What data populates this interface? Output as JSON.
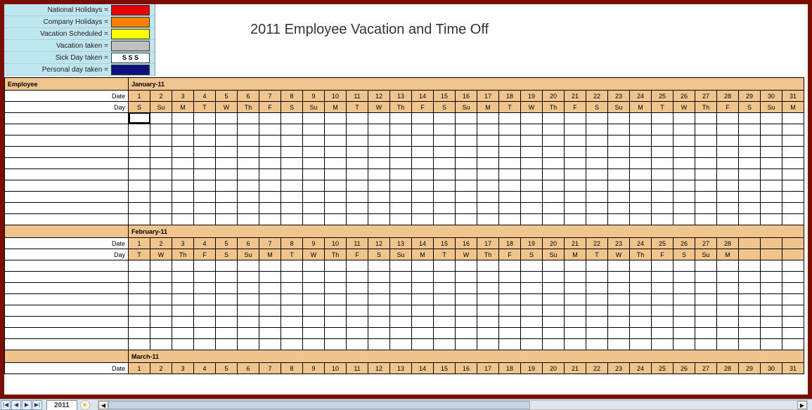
{
  "title": "2011 Employee Vacation and Time Off",
  "legend": [
    {
      "label": "National Holidays =",
      "color": "#e60000",
      "text": ""
    },
    {
      "label": "Company Holidays =",
      "color": "#ff7f00",
      "text": ""
    },
    {
      "label": "Vacation Scheduled =",
      "color": "#ffff00",
      "text": ""
    },
    {
      "label": "Vacation taken =",
      "color": "#bfbfbf",
      "text": ""
    },
    {
      "label": "Sick Day taken =",
      "color": "#ffffff",
      "text": "S   S   S"
    },
    {
      "label": "Personal day taken =",
      "color": "#10107f",
      "text": ""
    }
  ],
  "headers": {
    "employee": "Employee",
    "date_label": "Date",
    "day_label": "Day"
  },
  "months": [
    {
      "name": "January-11",
      "days_count": 31,
      "dates": [
        "1",
        "2",
        "3",
        "4",
        "5",
        "6",
        "7",
        "8",
        "9",
        "10",
        "11",
        "12",
        "13",
        "14",
        "15",
        "16",
        "17",
        "18",
        "19",
        "20",
        "21",
        "22",
        "23",
        "24",
        "25",
        "26",
        "27",
        "28",
        "29",
        "30",
        "31"
      ],
      "dows": [
        "S",
        "Su",
        "M",
        "T",
        "W",
        "Th",
        "F",
        "S",
        "Su",
        "M",
        "T",
        "W",
        "Th",
        "F",
        "S",
        "Su",
        "M",
        "T",
        "W",
        "Th",
        "F",
        "S",
        "Su",
        "M",
        "T",
        "W",
        "Th",
        "F",
        "S",
        "Su",
        "M"
      ],
      "blank_rows": 10
    },
    {
      "name": "February-11",
      "days_count": 28,
      "dates": [
        "1",
        "2",
        "3",
        "4",
        "5",
        "6",
        "7",
        "8",
        "9",
        "10",
        "11",
        "12",
        "13",
        "14",
        "15",
        "16",
        "17",
        "18",
        "19",
        "20",
        "21",
        "22",
        "23",
        "24",
        "25",
        "26",
        "27",
        "28"
      ],
      "dows": [
        "T",
        "W",
        "Th",
        "F",
        "S",
        "Su",
        "M",
        "T",
        "W",
        "Th",
        "F",
        "S",
        "Su",
        "M",
        "T",
        "W",
        "Th",
        "F",
        "S",
        "Su",
        "M",
        "T",
        "W",
        "Th",
        "F",
        "S",
        "Su",
        "M"
      ],
      "blank_rows": 8
    },
    {
      "name": "March-11",
      "days_count": 31,
      "dates": [
        "1",
        "2",
        "3",
        "4",
        "5",
        "6",
        "7",
        "8",
        "9",
        "10",
        "11",
        "12",
        "13",
        "14",
        "15",
        "16",
        "17",
        "18",
        "19",
        "20",
        "21",
        "22",
        "23",
        "24",
        "25",
        "26",
        "27",
        "28",
        "29",
        "30",
        "31"
      ],
      "dows": [],
      "blank_rows": 0
    }
  ],
  "sheet_tab": "2011",
  "nav_buttons": [
    "|◀",
    "◀",
    "▶",
    "▶|"
  ]
}
